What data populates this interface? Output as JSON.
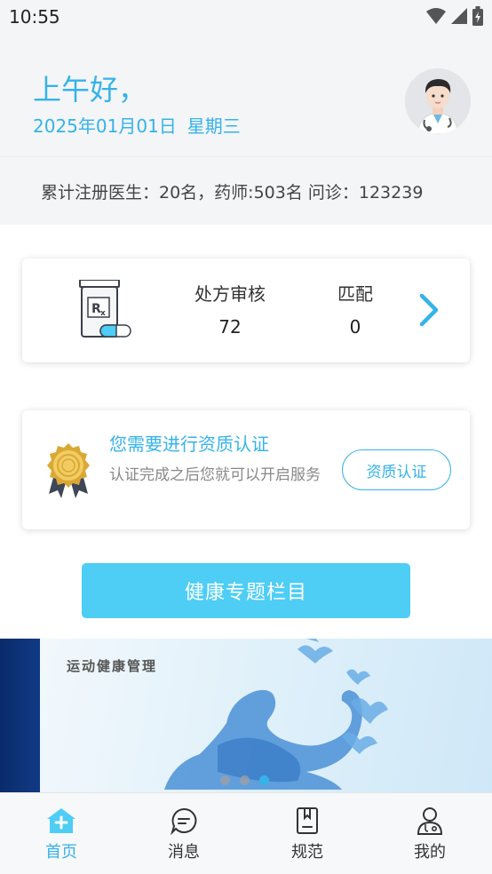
{
  "status_bar": {
    "time": "10:55"
  },
  "header": {
    "greeting": "上午好，",
    "date": "2025年01月01日",
    "weekday": "星期三"
  },
  "stats": {
    "text": "累计注册医生：20名，药师:503名  问诊：123239"
  },
  "rx_card": {
    "col1_label": "处方审核",
    "col1_value": "72",
    "col2_label": "匹配",
    "col2_value": "0"
  },
  "cert_card": {
    "title": "您需要进行资质认证",
    "desc": "认证完成之后您就可以开启服务",
    "button": "资质认证"
  },
  "health_button": "健康专题栏目",
  "banner": {
    "title": "运动健康管理",
    "dots": 3,
    "active_dot": 2
  },
  "tabs": [
    {
      "label": "首页",
      "icon": "home-icon"
    },
    {
      "label": "消息",
      "icon": "message-icon"
    },
    {
      "label": "规范",
      "icon": "guideline-icon"
    },
    {
      "label": "我的",
      "icon": "profile-icon"
    }
  ],
  "colors": {
    "accent": "#35b3e8",
    "button": "#4ecdf5"
  }
}
